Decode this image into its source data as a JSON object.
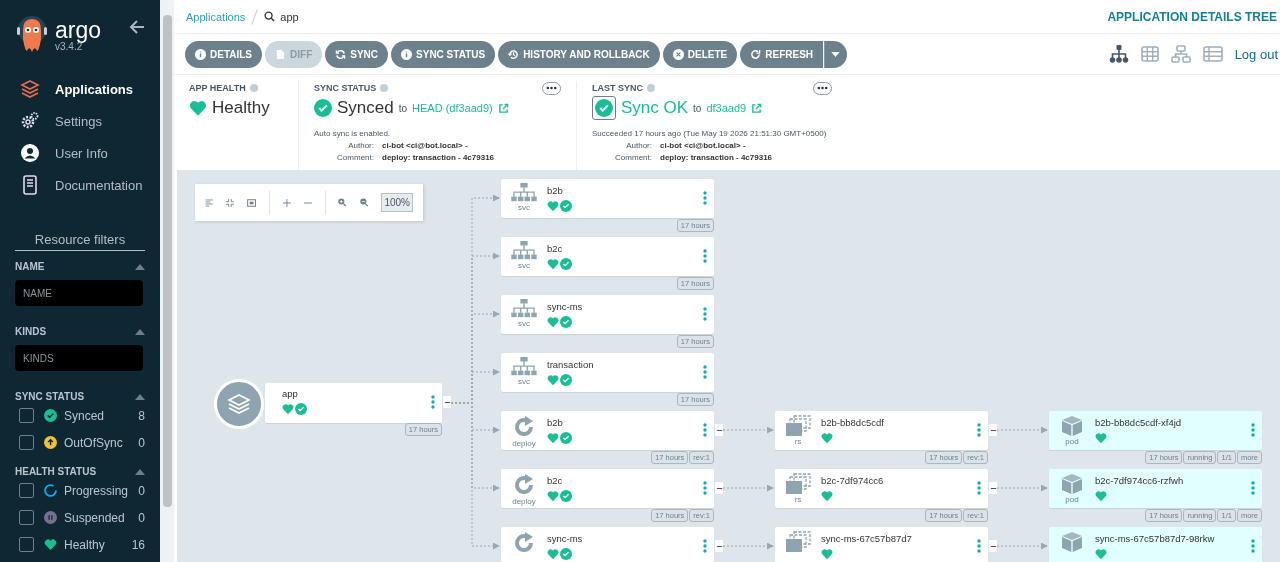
{
  "sidebar": {
    "logo": "argo",
    "version": "v3.4.2",
    "nav": [
      {
        "label": "Applications",
        "kind": "apps",
        "selected": true
      },
      {
        "label": "Settings",
        "kind": "settings",
        "selected": false
      },
      {
        "label": "User Info",
        "kind": "user",
        "selected": false
      },
      {
        "label": "Documentation",
        "kind": "docs",
        "selected": false
      }
    ],
    "filters_title": "Resource filters",
    "name_filter": {
      "title": "NAME",
      "placeholder": "NAME"
    },
    "kinds_filter": {
      "title": "KINDS",
      "placeholder": "KINDS"
    },
    "sync_filter": {
      "title": "SYNC STATUS",
      "items": [
        {
          "label": "Synced",
          "count": "8",
          "kind": "synced",
          "checked": false
        },
        {
          "label": "OutOfSync",
          "count": "0",
          "kind": "outofsync",
          "checked": false
        }
      ]
    },
    "health_filter": {
      "title": "HEALTH STATUS",
      "items": [
        {
          "label": "Progressing",
          "count": "0",
          "kind": "progressing",
          "checked": false
        },
        {
          "label": "Suspended",
          "count": "0",
          "kind": "suspended",
          "checked": false
        },
        {
          "label": "Healthy",
          "count": "16",
          "kind": "healthy",
          "checked": false
        }
      ]
    }
  },
  "breadcrumb": {
    "link": "Applications",
    "current": "app"
  },
  "page_title": "APPLICATION DETAILS TREE",
  "toolbar": {
    "buttons": [
      {
        "label": "DETAILS",
        "kind": "info",
        "disabled": false
      },
      {
        "label": "DIFF",
        "kind": "diff",
        "disabled": true
      },
      {
        "label": "SYNC",
        "kind": "sync",
        "disabled": false
      },
      {
        "label": "SYNC STATUS",
        "kind": "info",
        "disabled": false
      },
      {
        "label": "HISTORY AND ROLLBACK",
        "kind": "history",
        "disabled": false
      },
      {
        "label": "DELETE",
        "kind": "delete",
        "disabled": false
      },
      {
        "label": "REFRESH",
        "kind": "refresh",
        "disabled": false
      }
    ],
    "view_modes": [
      {
        "kind": "tree",
        "selected": true
      },
      {
        "kind": "pods",
        "selected": false
      },
      {
        "kind": "network",
        "selected": false
      },
      {
        "kind": "list",
        "selected": false
      }
    ],
    "logout": "Log out"
  },
  "app_health": {
    "title": "APP HEALTH",
    "status": "Healthy"
  },
  "sync_status": {
    "title": "SYNC STATUS",
    "status": "Synced",
    "to": "to",
    "revision": "HEAD (df3aad9)",
    "note": "Auto sync is enabled.",
    "author_label": "Author:",
    "author": "ci-bot <ci@bot.local> -",
    "comment_label": "Comment:",
    "comment": "deploy: transaction - 4c79316"
  },
  "last_sync": {
    "title": "LAST SYNC",
    "status": "Sync OK",
    "to": "to",
    "revision": "df3aad9",
    "note": "Succeeded 17 hours ago (Tue May 19 2026 21:51:30 GMT+0500)",
    "author_label": "Author:",
    "author": "ci-bot <ci@bot.local> -",
    "comment_label": "Comment:",
    "comment": "deploy: transaction - 4c79316"
  },
  "graph": {
    "zoom": "100%",
    "root": {
      "kind": "app",
      "name": "app",
      "healthy": true,
      "synced": true,
      "tags": [
        "17 hours"
      ],
      "expanded": true,
      "children": [
        {
          "kind": "svc",
          "type_label": "svc",
          "name": "b2b",
          "healthy": true,
          "synced": true,
          "tags": [
            "17 hours"
          ]
        },
        {
          "kind": "svc",
          "type_label": "svc",
          "name": "b2c",
          "healthy": true,
          "synced": true,
          "tags": [
            "17 hours"
          ]
        },
        {
          "kind": "svc",
          "type_label": "svc",
          "name": "sync-ms",
          "healthy": true,
          "synced": true,
          "tags": [
            "17 hours"
          ]
        },
        {
          "kind": "svc",
          "type_label": "svc",
          "name": "transaction",
          "healthy": true,
          "synced": true,
          "tags": [
            "17 hours"
          ]
        },
        {
          "kind": "deploy",
          "type_label": "deploy",
          "name": "b2b",
          "healthy": true,
          "synced": true,
          "tags": [
            "17 hours",
            "rev:1"
          ],
          "expanded": true,
          "children": [
            {
              "kind": "rs",
              "type_label": "rs",
              "name": "b2b-bb8dc5cdf",
              "healthy": true,
              "tags": [
                "17 hours",
                "rev:1"
              ],
              "expanded": true,
              "children": [
                {
                  "kind": "pod",
                  "type_label": "pod",
                  "name": "b2b-bb8dc5cdf-xf4jd",
                  "healthy": true,
                  "tags": [
                    "17 hours",
                    "running",
                    "1/1",
                    "more"
                  ]
                }
              ]
            }
          ]
        },
        {
          "kind": "deploy",
          "type_label": "deploy",
          "name": "b2c",
          "healthy": true,
          "synced": true,
          "tags": [
            "17 hours",
            "rev:1"
          ],
          "expanded": true,
          "children": [
            {
              "kind": "rs",
              "type_label": "rs",
              "name": "b2c-7df974cc6",
              "healthy": true,
              "tags": [
                "17 hours",
                "rev:1"
              ],
              "expanded": true,
              "children": [
                {
                  "kind": "pod",
                  "type_label": "pod",
                  "name": "b2c-7df974cc6-rzfwh",
                  "healthy": true,
                  "tags": [
                    "17 hours",
                    "running",
                    "1/1",
                    "more"
                  ]
                }
              ]
            }
          ]
        },
        {
          "kind": "deploy",
          "name": "sync-ms",
          "healthy": true,
          "synced": true,
          "expanded": true,
          "children": [
            {
              "kind": "rs",
              "name": "sync-ms-67c57b87d7",
              "healthy": true,
              "expanded": true,
              "children": [
                {
                  "kind": "pod",
                  "name": "sync-ms-67c57b87d7-98rkw",
                  "healthy": true
                }
              ]
            }
          ]
        }
      ]
    }
  }
}
